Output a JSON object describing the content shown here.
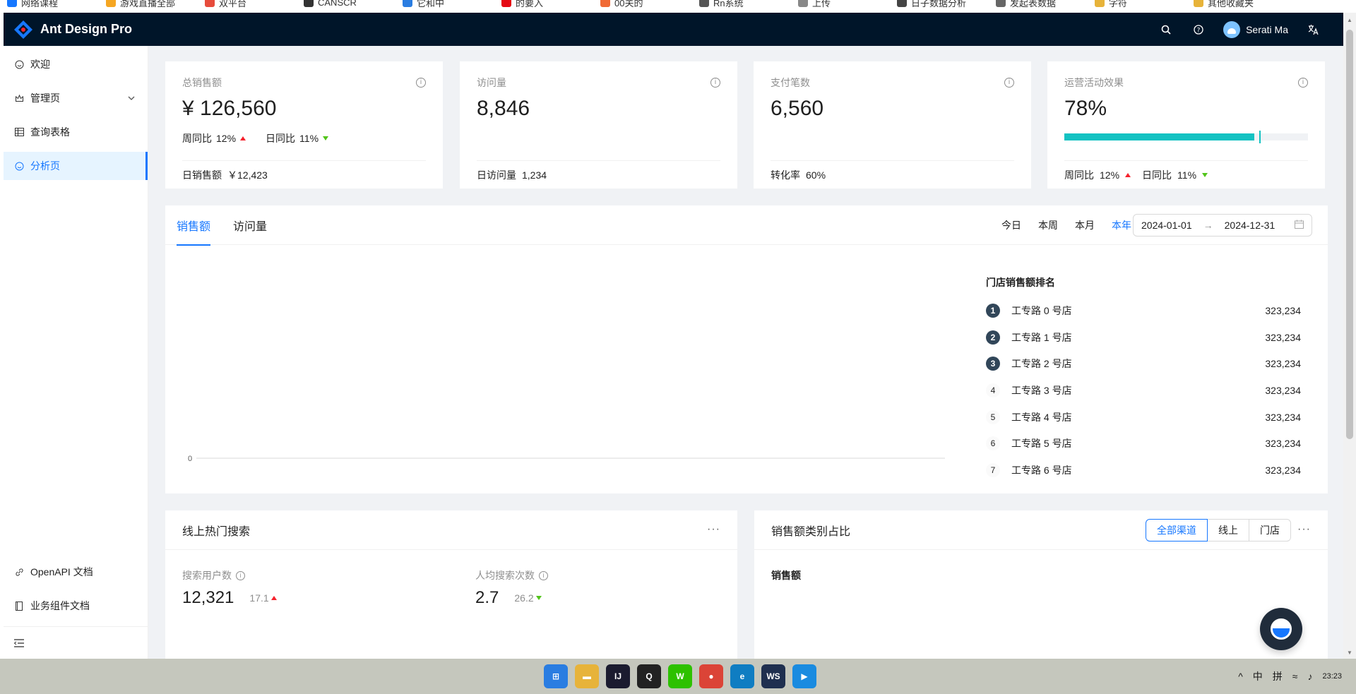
{
  "bookmarks": [
    "网络课程",
    "游戏直播全部",
    "双平台",
    "CANSCR",
    "它和中",
    "的要入",
    "00关的",
    "Rn系统",
    "上传",
    "日子数据分析",
    "发起表数据",
    "字符",
    "其他收藏夹"
  ],
  "header": {
    "title": "Ant Design Pro",
    "user_name": "Serati Ma"
  },
  "sidebar": {
    "items": [
      {
        "label": "欢迎",
        "icon": "smile-icon"
      },
      {
        "label": "管理页",
        "icon": "crown-icon"
      },
      {
        "label": "查询表格",
        "icon": "table-icon"
      },
      {
        "label": "分析页",
        "icon": "dashboard-icon"
      }
    ],
    "bottom_items": [
      {
        "label": "OpenAPI 文档",
        "icon": "link-icon"
      },
      {
        "label": "业务组件文档",
        "icon": "book-icon"
      }
    ]
  },
  "stats": [
    {
      "title": "总销售额",
      "value": "¥ 126,560",
      "week_label": "周同比",
      "week_value": "12%",
      "day_label": "日同比",
      "day_value": "11%",
      "footer_label": "日销售额",
      "footer_value": "￥12,423"
    },
    {
      "title": "访问量",
      "value": "8,846",
      "footer_label": "日访问量",
      "footer_value": "1,234"
    },
    {
      "title": "支付笔数",
      "value": "6,560",
      "footer_label": "转化率",
      "footer_value": "60%"
    },
    {
      "title": "运营活动效果",
      "value": "78%",
      "progress": 0.78,
      "target": 0.8,
      "week_label": "周同比",
      "week_value": "12%",
      "day_label": "日同比",
      "day_value": "11%"
    }
  ],
  "sales": {
    "tabs": [
      "销售额",
      "访问量"
    ],
    "ranges": [
      "今日",
      "本周",
      "本月",
      "本年"
    ],
    "date_start": "2024-01-01",
    "date_end": "2024-12-31",
    "chart_zero": "0",
    "rank_title": "门店销售额排名",
    "rank": [
      {
        "num": "1",
        "name": "工专路 0 号店",
        "value": "323,234"
      },
      {
        "num": "2",
        "name": "工专路 1 号店",
        "value": "323,234"
      },
      {
        "num": "3",
        "name": "工专路 2 号店",
        "value": "323,234"
      },
      {
        "num": "4",
        "name": "工专路 3 号店",
        "value": "323,234"
      },
      {
        "num": "5",
        "name": "工专路 4 号店",
        "value": "323,234"
      },
      {
        "num": "6",
        "name": "工专路 5 号店",
        "value": "323,234"
      },
      {
        "num": "7",
        "name": "工专路 6 号店",
        "value": "323,234"
      }
    ]
  },
  "search_card": {
    "title": "线上热门搜索",
    "users_label": "搜索用户数",
    "users_value": "12,321",
    "users_rate": "17.1",
    "avg_label": "人均搜索次数",
    "avg_value": "2.7",
    "avg_rate": "26.2"
  },
  "category_card": {
    "title": "销售额类别占比",
    "segments": [
      "全部渠道",
      "线上",
      "门店"
    ],
    "pie_title": "销售额"
  },
  "taskbar": {
    "time": "23:23",
    "ime1": "中",
    "ime2": "拼"
  },
  "colors": {
    "primary": "#1677ff",
    "header": "#001529",
    "progress": "#13c2c2",
    "up": "#f5222d",
    "down": "#52c41a"
  }
}
